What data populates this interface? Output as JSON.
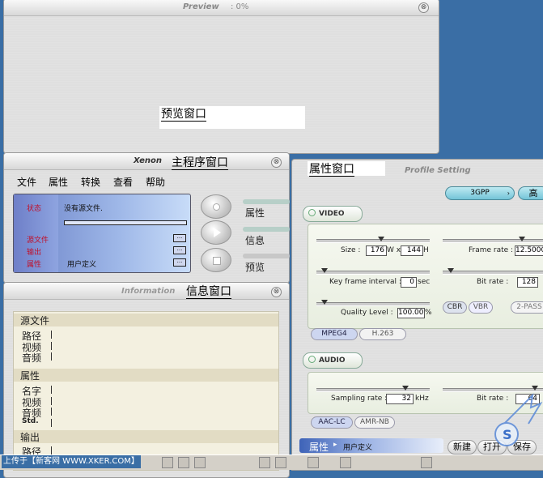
{
  "preview": {
    "title": "Preview",
    "percent": ": 0%",
    "label": "预览窗口"
  },
  "main": {
    "title": "Xenon",
    "label": "主程序窗口",
    "menu": [
      "文件",
      "属性",
      "转换",
      "查看",
      "帮助"
    ],
    "lcd": {
      "status_label": "状态",
      "status_value": "没有源文件.",
      "source_label": "源文件",
      "output_label": "输出",
      "property_label": "属性",
      "property_value": "用户定义",
      "dots": "..."
    },
    "side_tabs": [
      "属性",
      "信息",
      "预览"
    ]
  },
  "info": {
    "title": "Information",
    "label": "信息窗口",
    "sections": {
      "source": {
        "title": "源文件",
        "rows": [
          "路径",
          "视频",
          "音频"
        ]
      },
      "props": {
        "title": "属性",
        "rows": [
          "名字",
          "视频",
          "音频",
          "Std."
        ]
      },
      "output": {
        "title": "输出",
        "rows": [
          "路径"
        ]
      }
    }
  },
  "profile": {
    "label": "属性窗口",
    "title": "Profile Setting",
    "preset": "3GPP",
    "quality_btn": "高",
    "video": {
      "tab": "VIDEO",
      "size_label": "Size :",
      "width": "176",
      "w_sep": "W x",
      "height": "144",
      "h_unit": "H",
      "frame_rate_label": "Frame rate :",
      "frame_rate": "12.5000",
      "key_frame_label": "Key frame interval :",
      "key_frame": "0",
      "key_unit": "sec",
      "bit_rate_label": "Bit rate :",
      "bit_rate": "128",
      "quality_label": "Quality Level :",
      "quality": "100.00",
      "quality_unit": "%",
      "modes": [
        "CBR",
        "VBR",
        "2-PASS"
      ],
      "codecs": [
        "MPEG4",
        "H.263"
      ]
    },
    "audio": {
      "tab": "AUDIO",
      "sampling_label": "Sampling rate :",
      "sampling": "32",
      "sampling_unit": "kHz",
      "bit_rate_label": "Bit rate :",
      "bit_rate": "64",
      "codecs": [
        "AAC-LC",
        "AMR-NB"
      ]
    },
    "bottom": {
      "prop_label": "属性",
      "prop_value": "用户定义",
      "buttons": [
        "新建",
        "打开",
        "保存"
      ]
    }
  },
  "footer": {
    "upload_text": "上传于【新客网 WWW.XKER.COM】"
  }
}
